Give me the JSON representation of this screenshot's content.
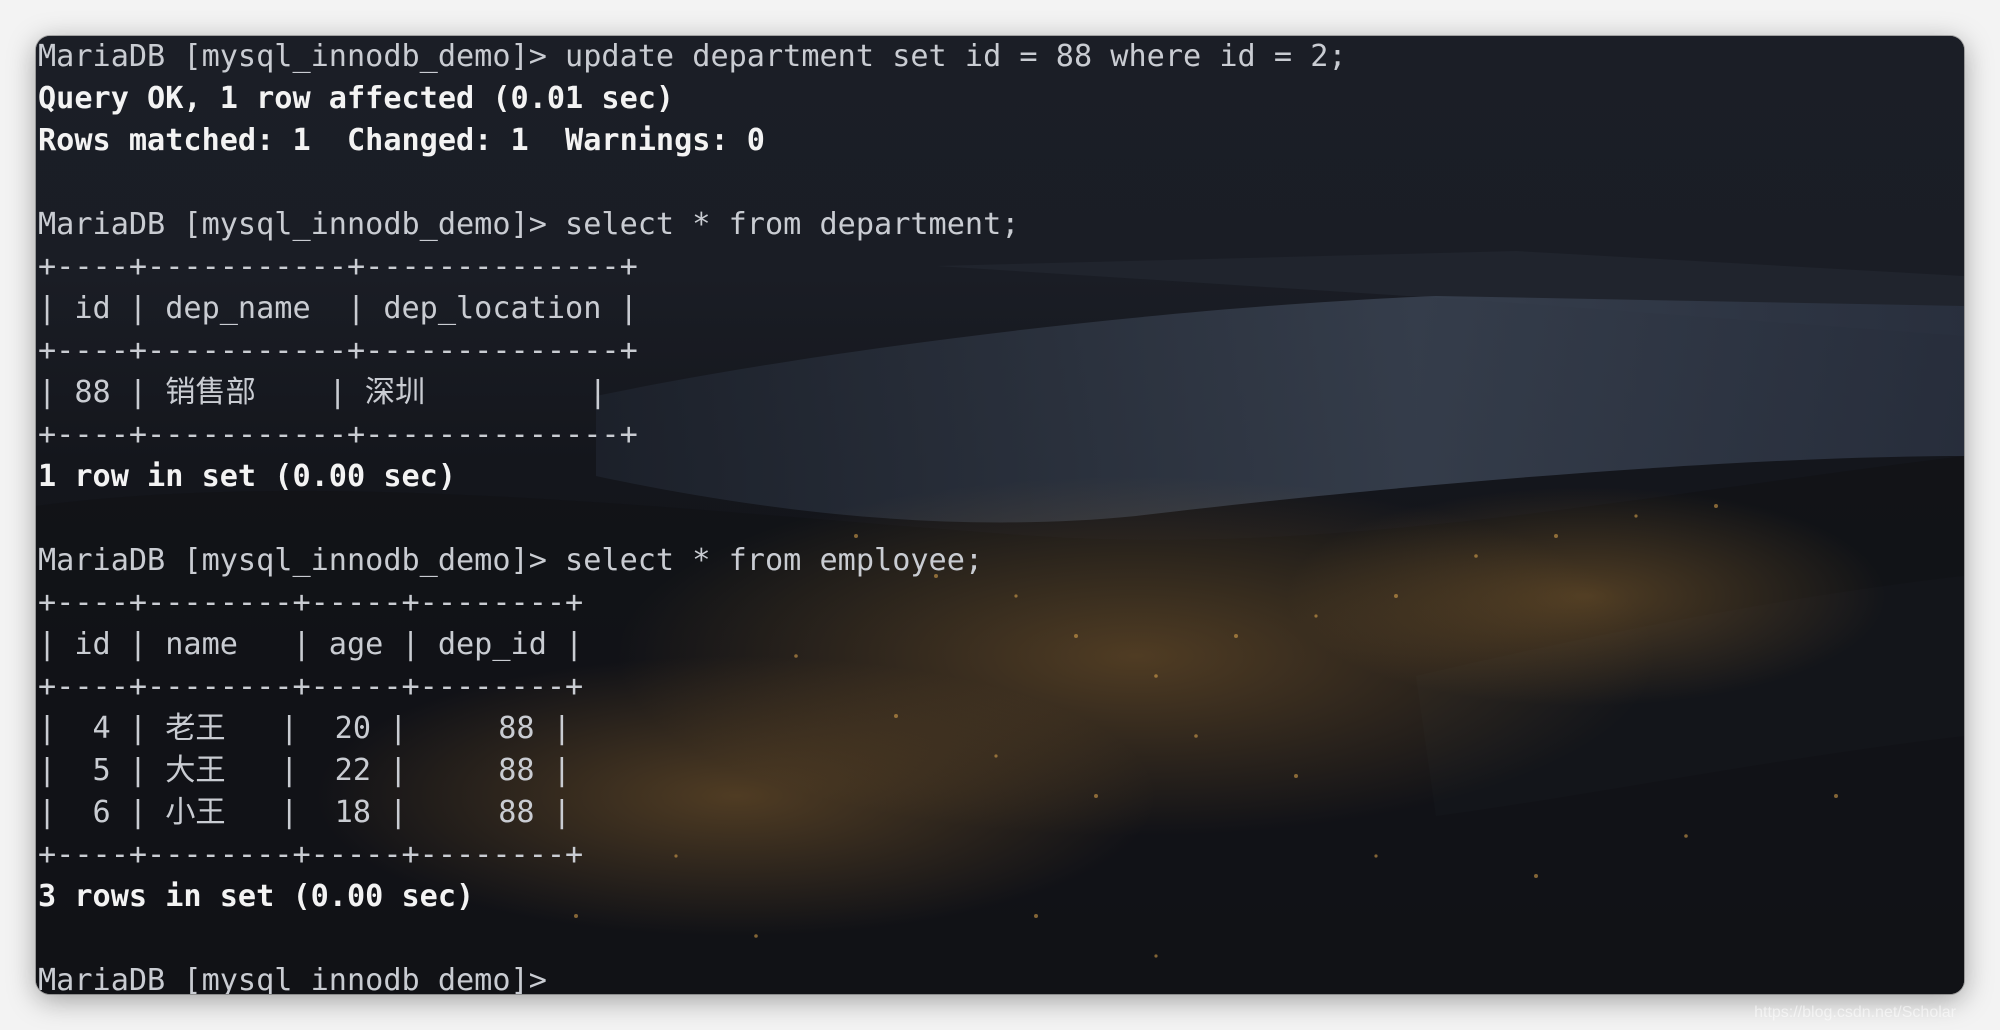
{
  "terminal": {
    "lines": [
      {
        "text": "MariaDB [mysql_innodb_demo]> update department set id = 88 where id = 2;",
        "style": "normal"
      },
      {
        "text": "Query OK, 1 row affected (0.01 sec)",
        "style": "bold"
      },
      {
        "text": "Rows matched: 1  Changed: 1  Warnings: 0",
        "style": "bold"
      },
      {
        "text": "",
        "style": "normal"
      },
      {
        "text": "MariaDB [mysql_innodb_demo]> select * from department;",
        "style": "normal"
      },
      {
        "text": "+----+-----------+--------------+",
        "style": "normal"
      },
      {
        "text": "| id | dep_name  | dep_location |",
        "style": "normal"
      },
      {
        "text": "+----+-----------+--------------+",
        "style": "normal"
      },
      {
        "text": "| 88 | 销售部    | 深圳         |",
        "style": "normal"
      },
      {
        "text": "+----+-----------+--------------+",
        "style": "normal"
      },
      {
        "text": "1 row in set (0.00 sec)",
        "style": "bold"
      },
      {
        "text": "",
        "style": "normal"
      },
      {
        "text": "MariaDB [mysql_innodb_demo]> select * from employee;",
        "style": "normal"
      },
      {
        "text": "+----+--------+-----+--------+",
        "style": "normal"
      },
      {
        "text": "| id | name   | age | dep_id |",
        "style": "normal"
      },
      {
        "text": "+----+--------+-----+--------+",
        "style": "normal"
      },
      {
        "text": "|  4 | 老王   |  20 |     88 |",
        "style": "normal"
      },
      {
        "text": "|  5 | 大王   |  22 |     88 |",
        "style": "normal"
      },
      {
        "text": "|  6 | 小王   |  18 |     88 |",
        "style": "normal"
      },
      {
        "text": "+----+--------+-----+--------+",
        "style": "normal"
      },
      {
        "text": "3 rows in set (0.00 sec)",
        "style": "bold"
      },
      {
        "text": "",
        "style": "normal"
      },
      {
        "text": "MariaDB [mysql_innodb_demo]> ",
        "style": "normal"
      }
    ]
  },
  "watermark": "https://blog.csdn.net/Scholar",
  "colors": {
    "terminal_text": "#c9ccd2",
    "bold_text": "#f3f3f3",
    "background": "#0f1117"
  }
}
